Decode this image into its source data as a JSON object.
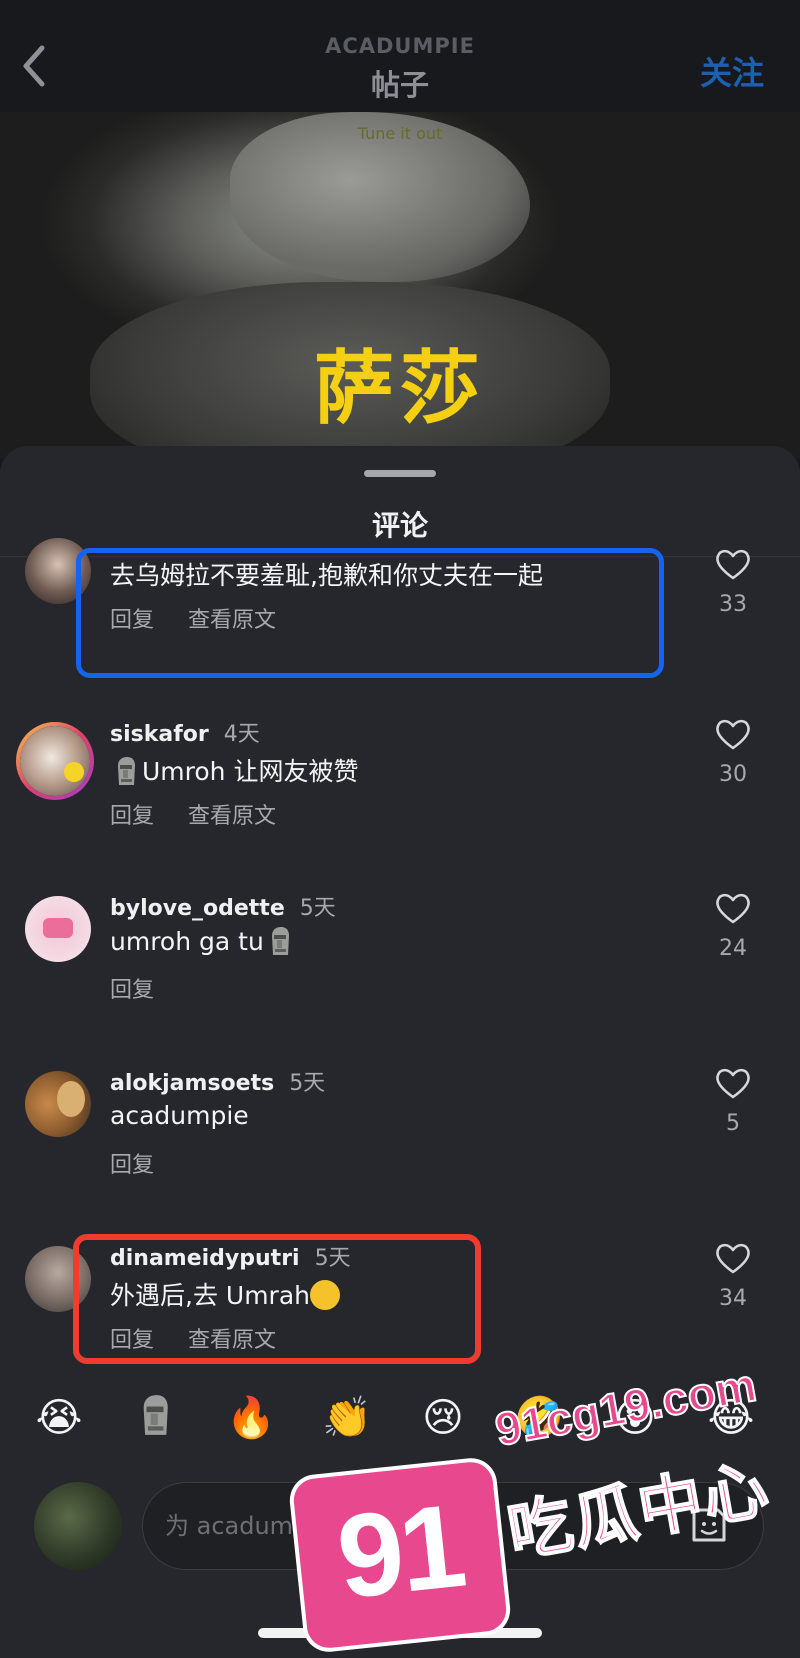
{
  "header": {
    "account": "ACADUMPIE",
    "title": "帖子",
    "follow_label": "关注"
  },
  "video": {
    "caption_small": "Tune it out",
    "caption_big": "萨莎"
  },
  "sheet": {
    "title": "评论"
  },
  "comments": [
    {
      "username": "",
      "time": "",
      "text": "去乌姆拉不要羞耻,抱歉和你丈夫在一起",
      "reply": "回复",
      "translate": "查看原文",
      "likes": "33"
    },
    {
      "username": "siskafor",
      "time": "4天",
      "text": "Umroh 让网友被赞",
      "reply": "回复",
      "translate": "查看原文",
      "likes": "30"
    },
    {
      "username": "bylove_odette",
      "time": "5天",
      "text": "umroh ga tu",
      "reply": "回复",
      "likes": "24"
    },
    {
      "username": "alokjamsoets",
      "time": "5天",
      "text": "acadumpie",
      "reply": "回复",
      "likes": "5"
    },
    {
      "username": "dinameidyputri",
      "time": "5天",
      "text": "外遇后,去 Umrah",
      "reply": "回复",
      "translate": "查看原文",
      "likes": "34"
    }
  ],
  "emoji_bar": [
    "😭",
    "🗿",
    "🔥",
    "👏",
    "😢",
    "🤣",
    "😮",
    "😂"
  ],
  "input": {
    "placeholder": "为 acadumpie 添加评论..."
  },
  "watermark": {
    "badge": "91",
    "domain": "91cg19.com",
    "name": "吃瓜中心"
  },
  "colors": {
    "accent_blue": "#1464f0",
    "accent_red": "#f13b2e",
    "caption_yellow": "#f4cf12",
    "watermark_pink": "#e8488e"
  }
}
